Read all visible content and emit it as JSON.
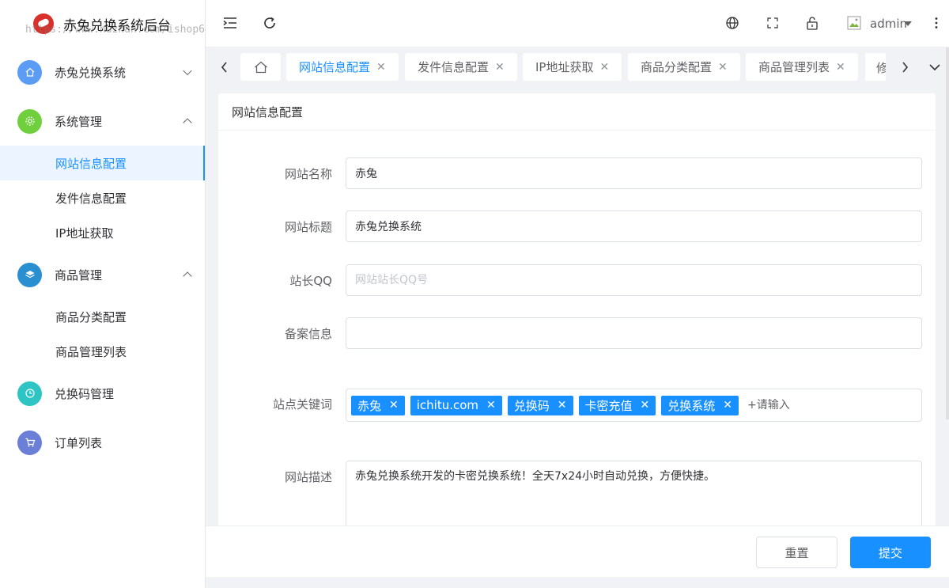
{
  "app": {
    "title": "赤兔兑换系统后台",
    "watermark": "https://www.huzhan.com/ishop6455"
  },
  "sidebar": {
    "menus": [
      {
        "label": "赤兔兑换系统",
        "icon": "home-icon",
        "color": "#5b9cf5",
        "expanded": false
      },
      {
        "label": "系统管理",
        "icon": "flower-icon",
        "color": "#6fcf3d",
        "expanded": true,
        "children": [
          {
            "label": "网站信息配置",
            "active": true
          },
          {
            "label": "发件信息配置",
            "active": false
          },
          {
            "label": "IP地址获取",
            "active": false
          }
        ]
      },
      {
        "label": "商品管理",
        "icon": "layers-icon",
        "color": "#2a8fd0",
        "expanded": true,
        "children": [
          {
            "label": "商品分类配置",
            "active": false
          },
          {
            "label": "商品管理列表",
            "active": false
          }
        ]
      },
      {
        "label": "兑换码管理",
        "icon": "clock-icon",
        "color": "#2ec4c4",
        "expanded": false
      },
      {
        "label": "订单列表",
        "icon": "cart-icon",
        "color": "#6b7fd6",
        "expanded": false
      }
    ]
  },
  "header": {
    "icons": [
      "menu-fold-icon",
      "refresh-icon",
      "globe-icon",
      "fullscreen-icon",
      "lock-icon"
    ],
    "user": "admin"
  },
  "tabs": {
    "items": [
      {
        "label": "网站信息配置",
        "active": true
      },
      {
        "label": "发件信息配置",
        "active": false
      },
      {
        "label": "IP地址获取",
        "active": false
      },
      {
        "label": "商品分类配置",
        "active": false
      },
      {
        "label": "商品管理列表",
        "active": false
      },
      {
        "label": "修",
        "active": false
      }
    ]
  },
  "card": {
    "title": "网站信息配置"
  },
  "form": {
    "site_name": {
      "label": "网站名称",
      "value": "赤兔"
    },
    "site_title": {
      "label": "网站标题",
      "value": "赤兔兑换系统"
    },
    "admin_qq": {
      "label": "站长QQ",
      "value": "",
      "placeholder": "网站站长QQ号"
    },
    "icp": {
      "label": "备案信息",
      "value": ""
    },
    "keywords": {
      "label": "站点关键词",
      "tags": [
        "赤兔",
        "ichitu.com",
        "兑换码",
        "卡密充值",
        "兑换系统"
      ],
      "placeholder": "+请输入"
    },
    "description": {
      "label": "网站描述",
      "value": "赤兔兑换系统开发的卡密兑换系统！全天7x24小时自动兑换，方便快捷。"
    }
  },
  "footer": {
    "reset_label": "重置",
    "submit_label": "提交"
  },
  "colors": {
    "primary": "#1890ff",
    "active_bg": "#ecf5ff"
  }
}
